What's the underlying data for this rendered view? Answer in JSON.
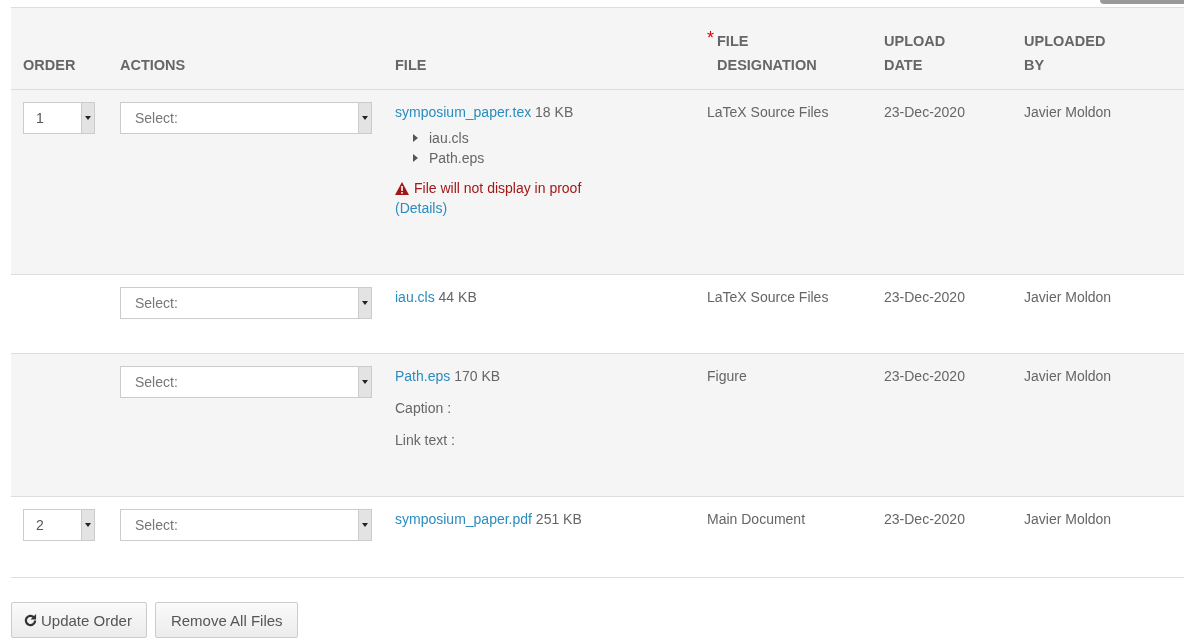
{
  "table": {
    "columns": [
      {
        "label": "ORDER"
      },
      {
        "label": "ACTIONS"
      },
      {
        "label": "FILE"
      },
      {
        "label": "FILE DESIGNATION",
        "required_mark": "*"
      },
      {
        "label": "UPLOAD DATE"
      },
      {
        "label": "UPLOADED BY"
      }
    ],
    "rows": [
      {
        "order": "1",
        "action": {
          "placeholder": "Select:"
        },
        "file": {
          "name": "symposium_paper.tex",
          "size": "18 KB",
          "children": [
            {
              "name": "iau.cls",
              "expanded": false
            },
            {
              "name": "Path.eps",
              "expanded": false
            }
          ],
          "warning": "File will not display in proof",
          "details_link": "(Details)"
        },
        "designation": "LaTeX Source Files",
        "date": "23-Dec-2020",
        "uploader": "Javier Moldon"
      },
      {
        "action": {
          "placeholder": "Select:"
        },
        "file": {
          "name": "iau.cls",
          "size": "44 KB"
        },
        "designation": "LaTeX Source Files",
        "date": "23-Dec-2020",
        "uploader": "Javier Moldon"
      },
      {
        "action": {
          "placeholder": "Select:"
        },
        "file": {
          "name": "Path.eps",
          "size": "170 KB",
          "fields": [
            "Caption :",
            "Link text :"
          ]
        },
        "designation": "Figure",
        "date": "23-Dec-2020",
        "uploader": "Javier Moldon"
      },
      {
        "order": "2",
        "action": {
          "placeholder": "Select:"
        },
        "file": {
          "name": "symposium_paper.pdf",
          "size": "251 KB"
        },
        "designation": "Main Document",
        "date": "23-Dec-2020",
        "uploader": "Javier Moldon"
      }
    ]
  },
  "buttons": [
    {
      "label": "Update Order",
      "kind": "refresh"
    },
    {
      "label": "Remove All Files",
      "kind": "plain"
    }
  ]
}
